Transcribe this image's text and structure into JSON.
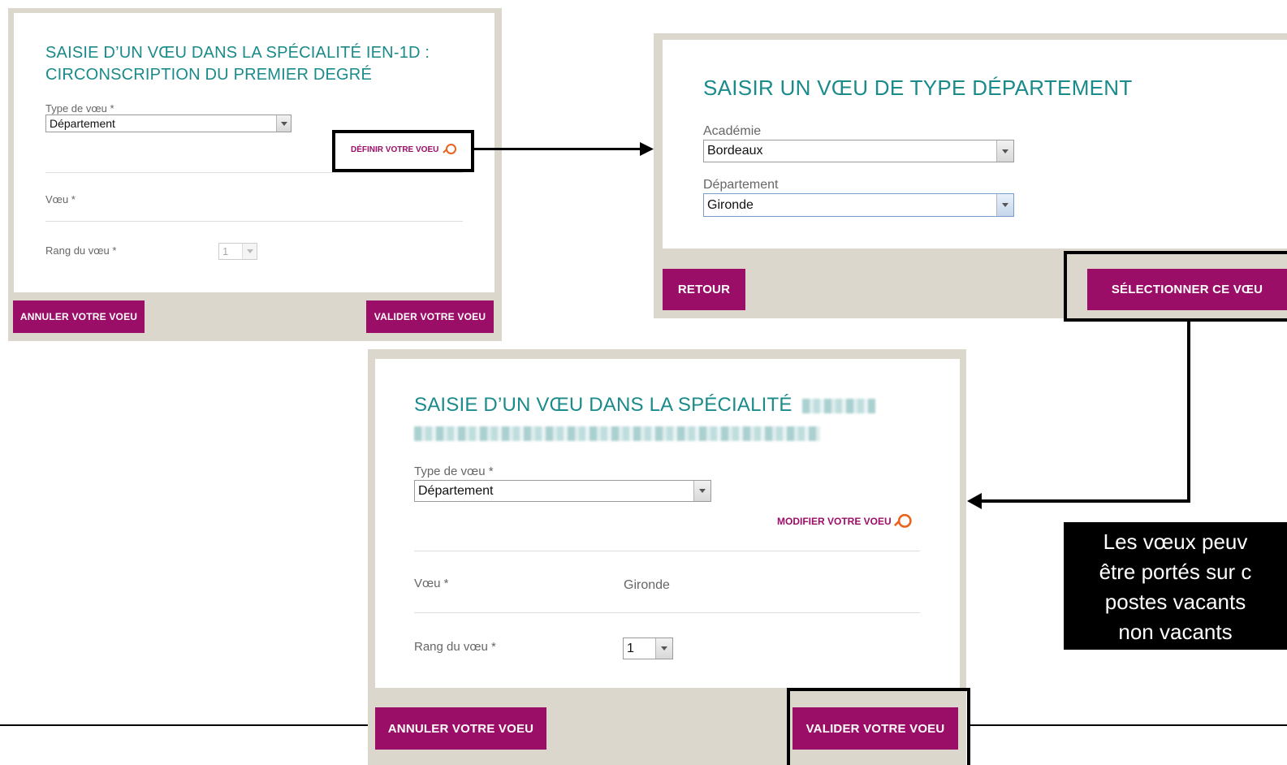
{
  "panel1": {
    "title_line1": "SAISIE D’UN VŒU DANS LA SPÉCIALITÉ IEN-1D :",
    "title_line2": "CIRCONSCRIPTION DU PREMIER DEGRÉ",
    "type_label": "Type de vœu *",
    "type_value": "Département",
    "define_link": "DÉFINIR VOTRE VOEU",
    "voeu_label": "Vœu *",
    "rang_label": "Rang du vœu *",
    "rang_value": "1",
    "cancel_button": "ANNULER VOTRE VOEU",
    "validate_button": "VALIDER VOTRE VOEU"
  },
  "panel2": {
    "title": "SAISIR UN VŒU DE TYPE DÉPARTEMENT",
    "academie_label": "Académie",
    "academie_value": "Bordeaux",
    "departement_label": "Département",
    "departement_value": "Gironde",
    "back_button": "RETOUR",
    "select_button": "SÉLECTIONNER CE VŒU"
  },
  "panel3": {
    "title_visible": "SAISIE D’UN VŒU DANS LA SPÉCIALITÉ",
    "type_label": "Type de vœu *",
    "type_value": "Département",
    "modify_link": "MODIFIER VOTRE VOEU",
    "voeu_label": "Vœu *",
    "voeu_value": "Gironde",
    "rang_label": "Rang du vœu *",
    "rang_value": "1",
    "cancel_button": "ANNULER VOTRE VOEU",
    "validate_button": "VALIDER VOTRE VOEU"
  },
  "note": {
    "line1": "Les vœux  peuv",
    "line2": "être portés sur c",
    "line3": "postes vacants",
    "line4": "non vacants"
  },
  "colors": {
    "brand": "#9b0e67",
    "title": "#1a8a8a",
    "panel_border": "#dcd7cc",
    "icon": "#e8641e"
  },
  "icons": {
    "search": "magnifier-icon",
    "select": "chevron-down-icon"
  }
}
